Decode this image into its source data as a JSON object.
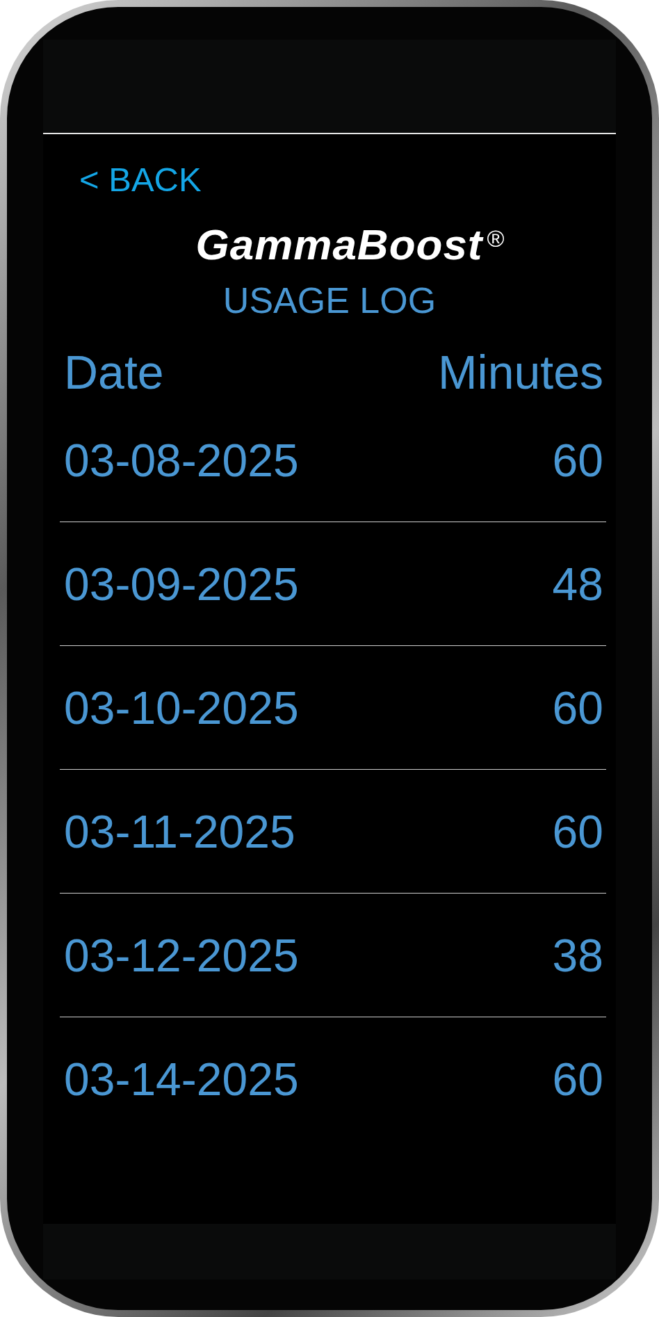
{
  "back_link": "< BACK",
  "logo": "GammaBoost$^{®}$",
  "title": "USAGE LOG",
  "table": {
    "columns": [
      "Date",
      "Minutes"
    ],
    "rows": [
      {
        "date": "03-08-2025",
        "minutes": "60"
      },
      {
        "date": "03-09-2025",
        "minutes": "48"
      },
      {
        "date": "03-10-2025",
        "minutes": "60"
      },
      {
        "date": "03-11-2025",
        "minutes": "60"
      },
      {
        "date": "03-12-2025",
        "minutes": "38"
      },
      {
        "date": "03-14-2025",
        "minutes": "60"
      }
    ]
  }
}
